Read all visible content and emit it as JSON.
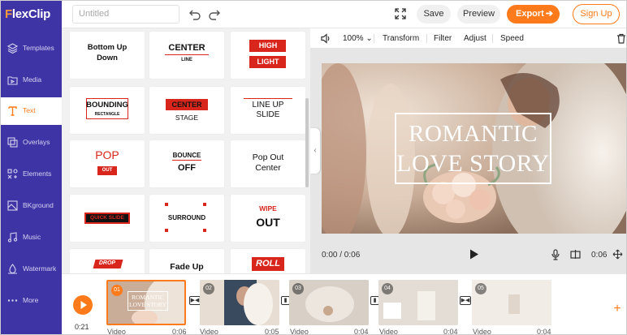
{
  "app": {
    "logo_f": "F",
    "logo_rest": "lexClip",
    "title_placeholder": "Untitled"
  },
  "header": {
    "save_label": "Save",
    "preview_label": "Preview",
    "export_label": "Export",
    "signup_label": "Sign Up"
  },
  "sidebar": {
    "items": [
      {
        "label": "Templates",
        "icon": "templates-icon"
      },
      {
        "label": "Media",
        "icon": "media-icon"
      },
      {
        "label": "Text",
        "icon": "text-icon"
      },
      {
        "label": "Overlays",
        "icon": "overlays-icon"
      },
      {
        "label": "Elements",
        "icon": "elements-icon"
      },
      {
        "label": "BKground",
        "icon": "background-icon"
      },
      {
        "label": "Music",
        "icon": "music-icon"
      },
      {
        "label": "Watermark",
        "icon": "watermark-icon"
      },
      {
        "label": "More",
        "icon": "more-icon"
      }
    ],
    "active_index": 2
  },
  "text_presets": [
    {
      "l1": "Bottom Up",
      "l2": "Down"
    },
    {
      "l1": "CENTER",
      "l2": "LINE"
    },
    {
      "l1": "HIGH",
      "l2": "LIGHT"
    },
    {
      "l1": "BOUNDING",
      "l2": "RECTANGLE"
    },
    {
      "l1": "CENTER",
      "l2": "STAGE"
    },
    {
      "l1": "LINE UP",
      "l2": "SLIDE"
    },
    {
      "l1": "POP",
      "l2": "OUT"
    },
    {
      "l1": "BOUNCE",
      "l2": "OFF"
    },
    {
      "l1": "Pop Out",
      "l2": "Center"
    },
    {
      "l1": "QUICK SLIDE",
      "l2": ""
    },
    {
      "l1": "SURROUND",
      "l2": ""
    },
    {
      "l1": "WIPE",
      "l2": "OUT"
    },
    {
      "l1": "DROP",
      "l2": ""
    },
    {
      "l1": "Fade Up",
      "l2": ""
    },
    {
      "l1": "ROLL",
      "l2": ""
    }
  ],
  "editor": {
    "zoom": "100%",
    "tools": [
      "Transform",
      "Filter",
      "Adjust",
      "Speed"
    ],
    "video_title_line1": "ROMANTIC",
    "video_title_line2": "LOVE STORY",
    "current_time": "0:00 / 0:06",
    "end_time": "0:06"
  },
  "timeline": {
    "current_time": "0:21",
    "clips": [
      {
        "num": "01",
        "label": "Video",
        "duration": "0:06",
        "thumb_title_1": "ROMANTIC",
        "thumb_title_2": "LOVE STORY"
      },
      {
        "num": "02",
        "label": "Video",
        "duration": "0:05"
      },
      {
        "num": "03",
        "label": "Video",
        "duration": "0:04"
      },
      {
        "num": "04",
        "label": "Video",
        "duration": "0:04"
      },
      {
        "num": "05",
        "label": "Video",
        "duration": "0:04"
      }
    ]
  },
  "colors": {
    "brand": "#3e34a5",
    "accent": "#ff7a1a",
    "preset_red": "#d8261c"
  }
}
